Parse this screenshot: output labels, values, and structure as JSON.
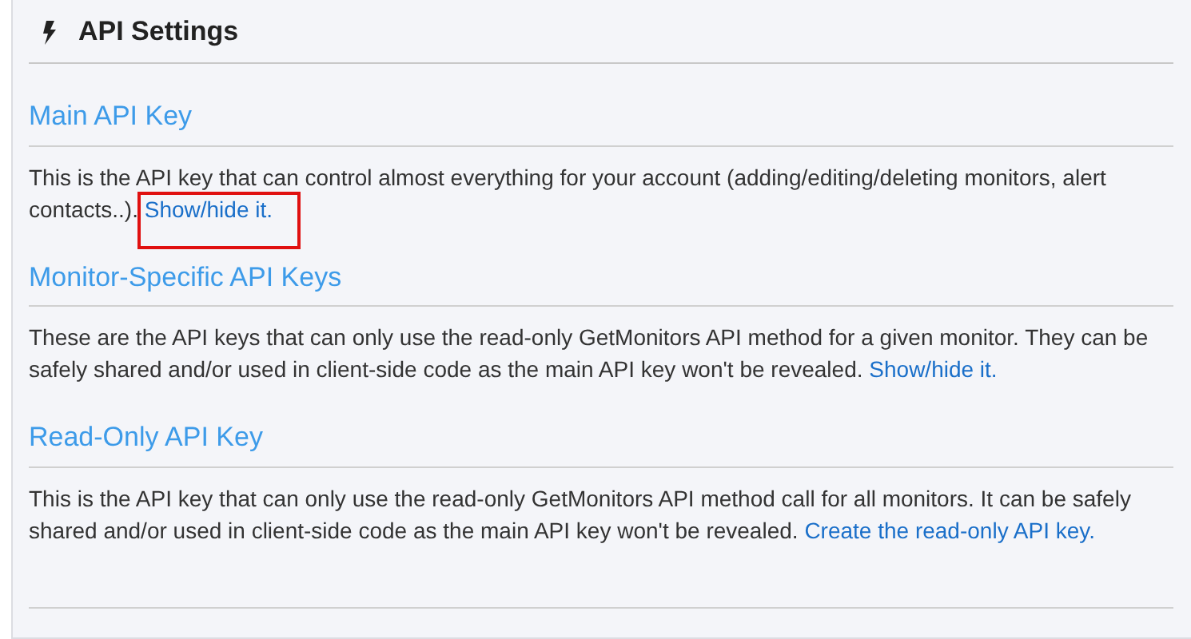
{
  "panel": {
    "title": "API Settings",
    "sections": [
      {
        "heading": "Main API Key",
        "text": "This is the API key that can control almost everything for your account (adding/editing/deleting monitors, alert contacts..).",
        "link": {
          "label": "Show/hide it.",
          "highlighted": true
        }
      },
      {
        "heading": "Monitor-Specific API Keys",
        "text": "These are the API keys that can only use the read-only GetMonitors API method for a given monitor. They can be safely shared and/or used in client-side code as the main API key won't be revealed.",
        "link": {
          "label": "Show/hide it.",
          "highlighted": false
        }
      },
      {
        "heading": "Read-Only API Key",
        "text": "This is the API key that can only use the read-only GetMonitors API method call for all monitors. It can be safely shared and/or used in client-side code as the main API key won't be revealed.",
        "link": {
          "label": "Create the read-only API key.",
          "highlighted": false
        }
      }
    ]
  }
}
